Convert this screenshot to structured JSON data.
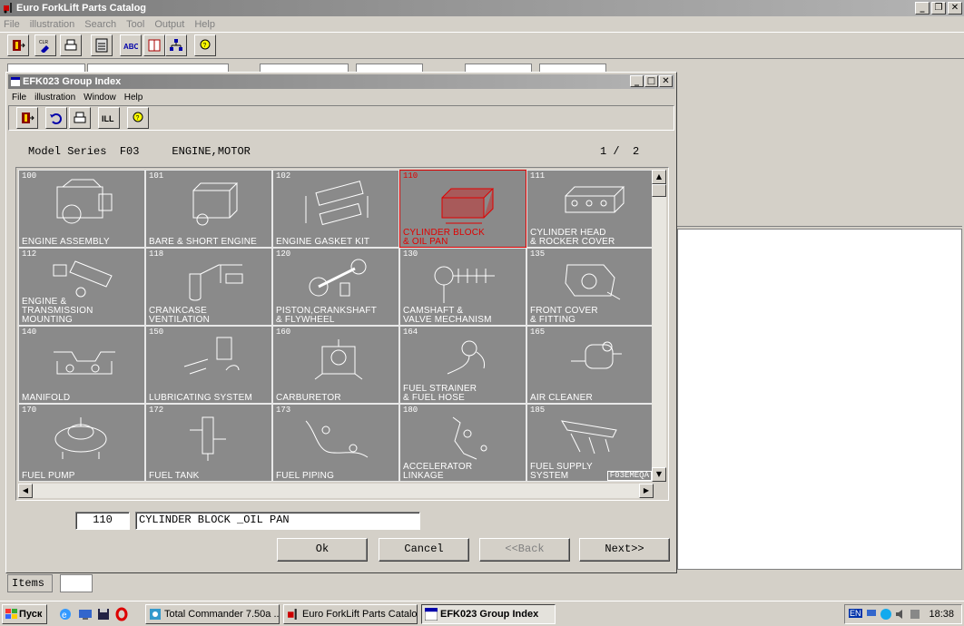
{
  "app": {
    "title": "Euro ForkLift Parts Catalog",
    "menu": [
      "File",
      "illustration",
      "Search",
      "Tool",
      "Output",
      "Help"
    ]
  },
  "inner": {
    "title": "EFK023 Group Index",
    "menu": [
      "File",
      "illustration",
      "Window",
      "Help"
    ],
    "header": "Model Series  F03     ENGINE,MOTOR",
    "page": "1 /  2",
    "cells": [
      {
        "code": "100",
        "label": "ENGINE ASSEMBLY"
      },
      {
        "code": "101",
        "label": "BARE & SHORT ENGINE"
      },
      {
        "code": "102",
        "label": "ENGINE GASKET KIT"
      },
      {
        "code": "110",
        "label": "CYLINDER BLOCK\n& OIL PAN",
        "selected": true
      },
      {
        "code": "111",
        "label": "CYLINDER HEAD\n& ROCKER COVER"
      },
      {
        "code": "112",
        "label": "ENGINE &\nTRANSMISSION\nMOUNTING"
      },
      {
        "code": "118",
        "label": "CRANKCASE\nVENTILATION"
      },
      {
        "code": "120",
        "label": "PISTON,CRANKSHAFT\n& FLYWHEEL"
      },
      {
        "code": "130",
        "label": "CAMSHAFT &\nVALVE MECHANISM"
      },
      {
        "code": "135",
        "label": "FRONT COVER\n& FITTING"
      },
      {
        "code": "140",
        "label": "MANIFOLD"
      },
      {
        "code": "150",
        "label": "LUBRICATING SYSTEM"
      },
      {
        "code": "160",
        "label": "CARBURETOR"
      },
      {
        "code": "164",
        "label": "FUEL STRAINER\n& FUEL HOSE"
      },
      {
        "code": "165",
        "label": "AIR CLEANER"
      },
      {
        "code": "170",
        "label": "FUEL PUMP"
      },
      {
        "code": "172",
        "label": "FUEL TANK"
      },
      {
        "code": "173",
        "label": "FUEL PIPING"
      },
      {
        "code": "180",
        "label": "ACCELERATOR\nLINKAGE"
      },
      {
        "code": "185",
        "label": "FUEL SUPPLY\nSYSTEM"
      }
    ],
    "watermark": "F03EMEQA",
    "selected_code": "110",
    "selected_name": "CYLINDER BLOCK _OIL PAN",
    "buttons": {
      "ok": "Ok",
      "cancel": "Cancel",
      "back": "<<Back",
      "next": "Next>>"
    }
  },
  "bottom": {
    "items_label": "Items"
  },
  "taskbar": {
    "start": "Пуск",
    "tasks": [
      "Total Commander 7.50a ...",
      "Euro ForkLift Parts Catalog",
      "EFK023 Group Index"
    ],
    "lang": "EN",
    "clock": "18:38"
  }
}
